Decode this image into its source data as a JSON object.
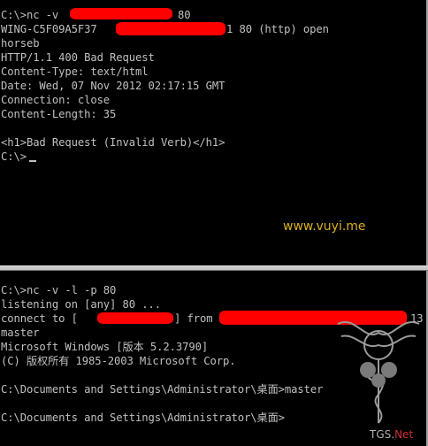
{
  "top_console": {
    "lines": [
      "C:\\>nc -v ",
      "WING-C5F09A5F37 ",
      "horseb",
      "HTTP/1.1 400 Bad Request",
      "Content-Type: text/html",
      "Date: Wed, 07 Nov 2012 02:17:15 GMT",
      "Connection: close",
      "Content-Length: 35",
      "",
      "<h1>Bad Request (Invalid Verb)</h1>",
      "C:\\>"
    ],
    "line1_tail": "80",
    "line2_tail": "1 80 (http) open"
  },
  "watermark": "www.vuyi.me",
  "bottom_console": {
    "lines": [
      "C:\\>nc -v -l -p 80",
      "listening on [any] 80 ...",
      "connect to [",
      "master",
      "Microsoft Windows [版本 5.2.3790]",
      "(C) 版权所有 1985-2003 Microsoft Corp.",
      "",
      "C:\\Documents and Settings\\Administrator\\桌面>master",
      "",
      "C:\\Documents and Settings\\Administrator\\桌面>"
    ],
    "line3_mid": "] from",
    "line3_tail": "13"
  },
  "bottom_mark": {
    "prefix": "T",
    "middle": "GS.",
    "suffix": "Net"
  },
  "colors": {
    "text": "#c0c0c0",
    "background": "#000000",
    "redaction": "#ff0000",
    "watermark": "#d8b020"
  }
}
